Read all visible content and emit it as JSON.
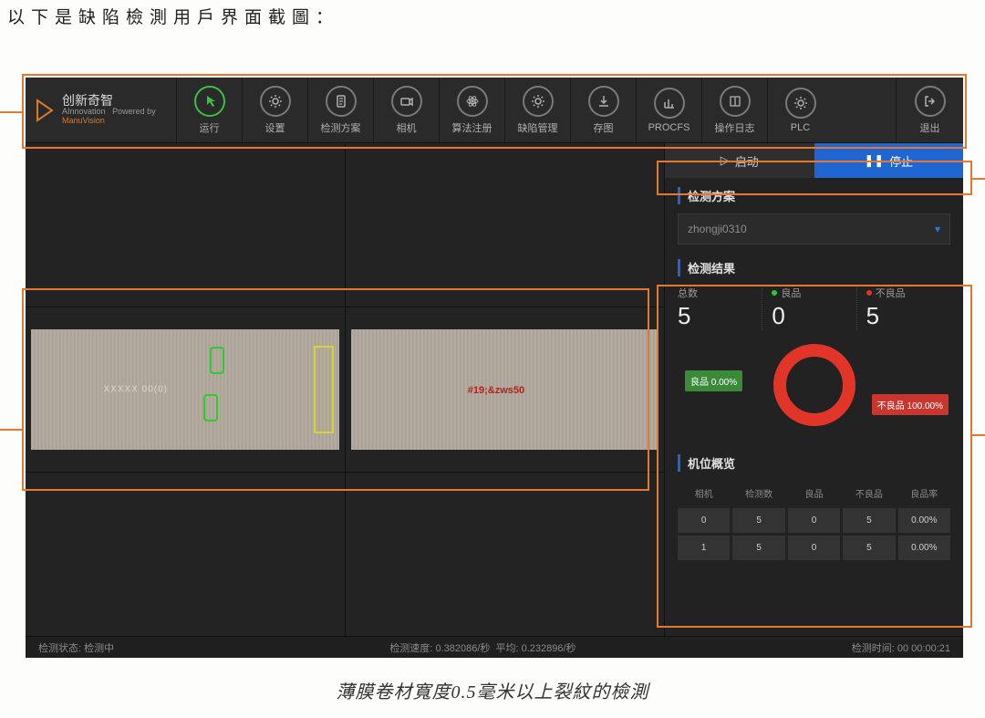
{
  "doc": {
    "heading": "以下是缺陷檢測用戶界面截圖：",
    "caption": "薄膜卷材寬度0.5毫米以上裂紋的檢測"
  },
  "brand": {
    "title": "创新奇智",
    "sub_en": "AInnovation",
    "powered_label": "Powered by",
    "powered_brand": "ManuVision"
  },
  "toolbar": {
    "items": [
      {
        "label": "运行",
        "icon": "pointer",
        "active": true
      },
      {
        "label": "设置",
        "icon": "gear"
      },
      {
        "label": "检测方案",
        "icon": "doc"
      },
      {
        "label": "相机",
        "icon": "camera"
      },
      {
        "label": "算法注册",
        "icon": "atom"
      },
      {
        "label": "缺陷管理",
        "icon": "gear"
      },
      {
        "label": "存图",
        "icon": "download"
      },
      {
        "label": "PROCFS",
        "icon": "chart"
      },
      {
        "label": "操作日志",
        "icon": "book"
      },
      {
        "label": "PLC",
        "icon": "gear"
      }
    ],
    "exit_label": "退出"
  },
  "run": {
    "start": "启动",
    "stop": "停止"
  },
  "plan": {
    "header": "检测方案",
    "selected": "zhongji0310"
  },
  "result": {
    "header": "检测结果",
    "total_label": "总数",
    "total_value": "5",
    "ok_label": "良品",
    "ok_value": "0",
    "ng_label": "不良品",
    "ng_value": "5",
    "ok_chip": "良品 0.00%",
    "ng_chip": "不良品 100.00%"
  },
  "feed": {
    "label_left": "XXXXX 00(0)",
    "label_right": "#19;&zws50"
  },
  "overview": {
    "header": "机位概览",
    "cols": [
      "相机",
      "检测数",
      "良品",
      "不良品",
      "良品率"
    ],
    "rows": [
      [
        "0",
        "5",
        "0",
        "5",
        "0.00%"
      ],
      [
        "1",
        "5",
        "0",
        "5",
        "0.00%"
      ]
    ]
  },
  "footer": {
    "status_label": "检测状态:",
    "status_value": "检测中",
    "speed_label": "检测速度:",
    "speed_value": "0.382086/秒",
    "avg_label": "平均:",
    "avg_value": "0.232896/秒",
    "time_label": "检测时间:",
    "time_value": "00 00:00:21"
  },
  "chart_data": {
    "type": "pie",
    "title": "良品 / 不良品",
    "series": [
      {
        "name": "良品",
        "value": 0,
        "pct": 0.0,
        "color": "#3a8a3a"
      },
      {
        "name": "不良品",
        "value": 5,
        "pct": 100.0,
        "color": "#e2352a"
      }
    ]
  }
}
